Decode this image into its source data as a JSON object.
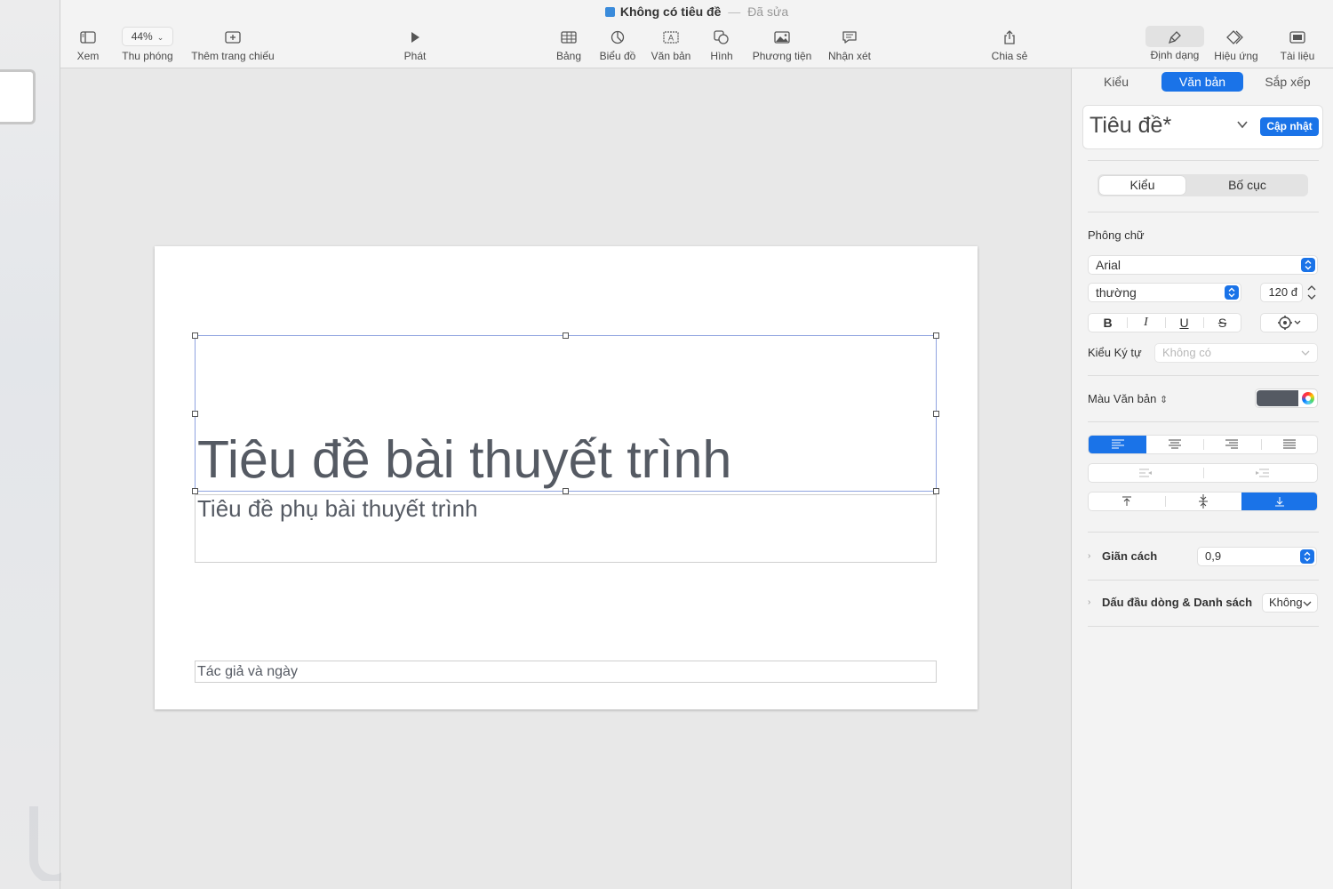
{
  "window": {
    "doc_title": "Không có tiêu đề",
    "doc_separator": "—",
    "doc_status": "Đã sửa"
  },
  "toolbar": {
    "view_label": "Xem",
    "zoom_value": "44%",
    "zoom_label": "Thu phóng",
    "add_slide_label": "Thêm trang chiếu",
    "play_label": "Phát",
    "table_label": "Bảng",
    "chart_label": "Biểu đồ",
    "text_label": "Văn bản",
    "shape_label": "Hình",
    "media_label": "Phương tiện",
    "comment_label": "Nhận xét",
    "share_label": "Chia sẻ",
    "format_label": "Định dạng",
    "animate_label": "Hiệu ứng",
    "document_label": "Tài liệu"
  },
  "slide": {
    "title": "Tiêu đề bài thuyết trình",
    "subtitle": "Tiêu đề phụ bài thuyết trình",
    "author": "Tác giả và ngày"
  },
  "inspector": {
    "tabs": [
      "Kiểu",
      "Văn bản",
      "Sắp xếp"
    ],
    "active_tab": "Văn bản",
    "paragraph_style": "Tiêu đề*",
    "update_button": "Cập nhật",
    "subtabs": [
      "Kiểu",
      "Bố cục"
    ],
    "font_section": "Phông chữ",
    "font_family": "Arial",
    "font_weight": "thường",
    "font_size": "120 đ",
    "bold": "B",
    "italic": "I",
    "underline": "U",
    "strike": "S",
    "char_style_label": "Kiểu Ký tự",
    "char_style_value": "Không có",
    "text_color_label": "Màu Văn bản",
    "text_color": "#555a63",
    "accent_color": "#1a73e8",
    "spacing_label": "Giãn cách",
    "spacing_value": "0,9",
    "bullets_label": "Dấu đầu dòng & Danh sách",
    "bullets_value": "Không"
  }
}
